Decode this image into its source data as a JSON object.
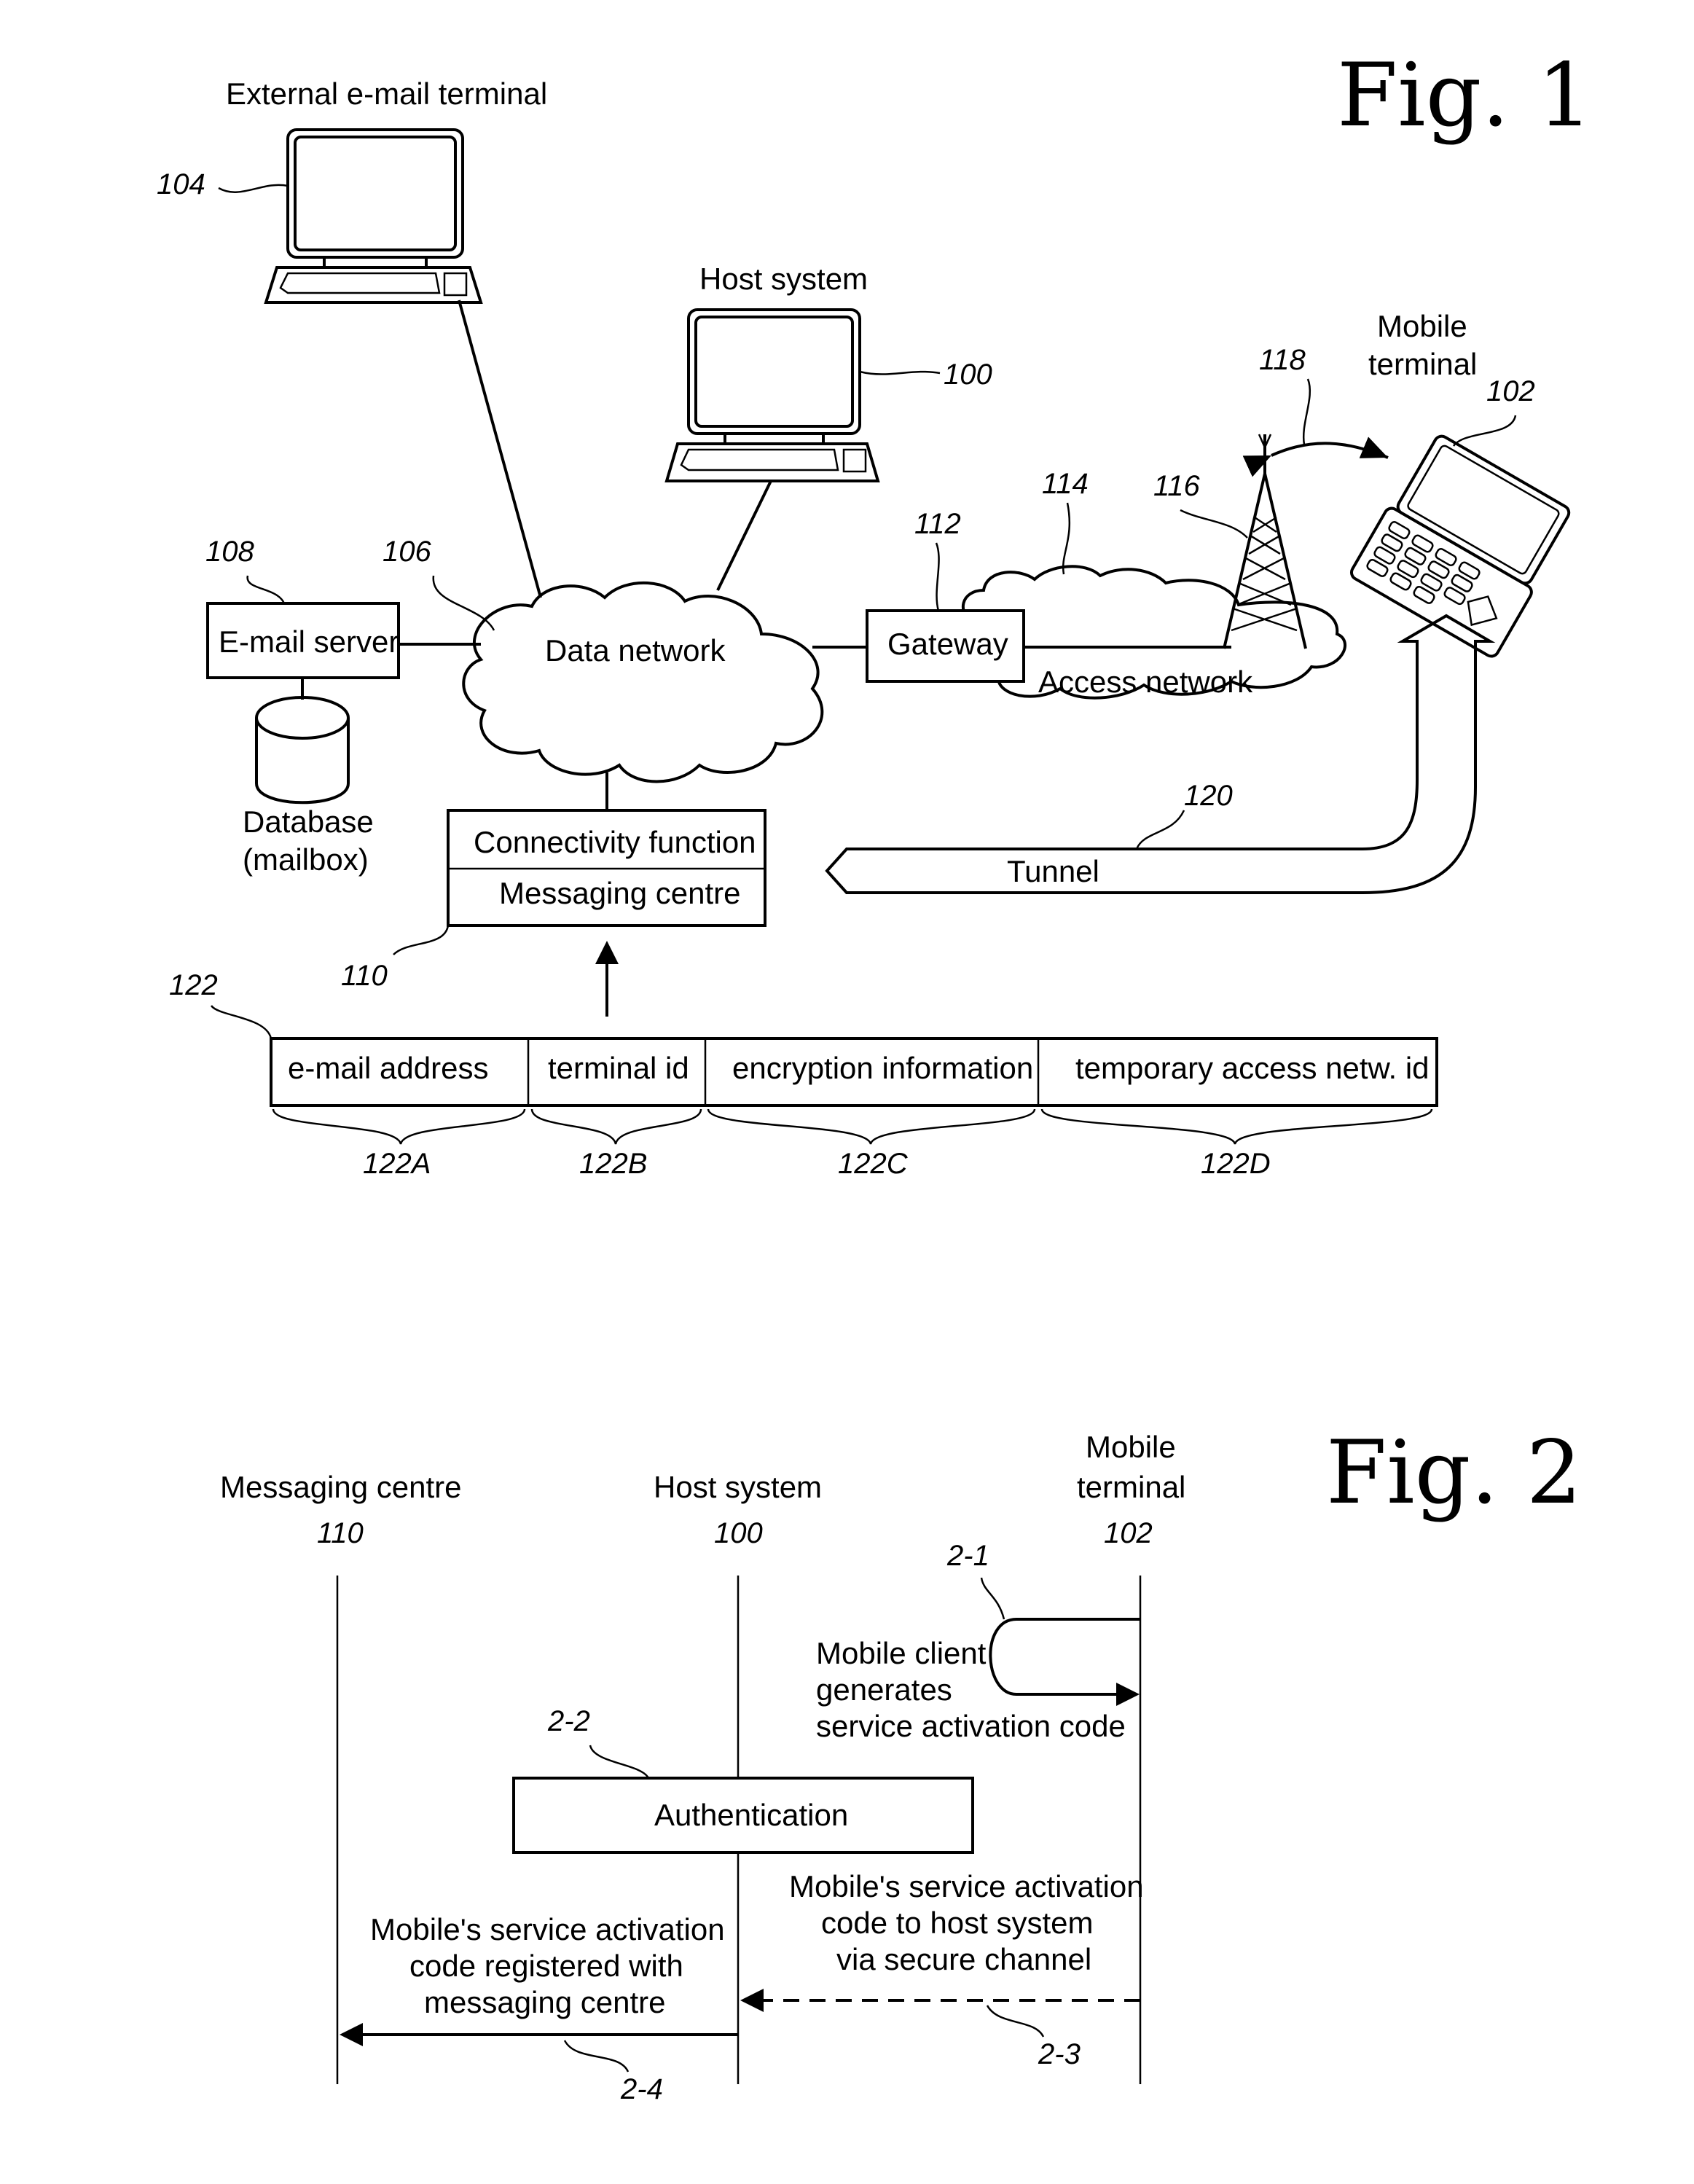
{
  "fig1": {
    "title": "Fig. 1",
    "external_terminal": {
      "label": "External e-mail terminal",
      "ref": "104"
    },
    "host_system": {
      "label": "Host system",
      "ref": "100"
    },
    "mobile_terminal": {
      "label_line1": "Mobile",
      "label_line2": "terminal",
      "ref": "102"
    },
    "radio_link_ref": "118",
    "tower_ref": "116",
    "access_network": {
      "label": "Access network",
      "ref": "114"
    },
    "gateway": {
      "label": "Gateway",
      "ref": "112"
    },
    "data_network": {
      "label": "Data network",
      "ref": "106"
    },
    "email_server": {
      "label": "E-mail server",
      "ref": "108"
    },
    "database": {
      "label_line1": "Database",
      "label_line2": "(mailbox)"
    },
    "connectivity": {
      "top": "Connectivity function",
      "bottom": "Messaging centre",
      "ref": "110"
    },
    "tunnel": {
      "label": "Tunnel",
      "ref": "120"
    },
    "message": {
      "ref": "122",
      "fields": [
        {
          "label": "e-mail address",
          "ref": "122A"
        },
        {
          "label": "terminal id",
          "ref": "122B"
        },
        {
          "label": "encryption information",
          "ref": "122C"
        },
        {
          "label": "temporary access netw. id",
          "ref": "122D"
        }
      ]
    }
  },
  "fig2": {
    "title": "Fig. 2",
    "lifelines": [
      {
        "label": "Messaging centre",
        "ref": "110"
      },
      {
        "label": "Host system",
        "ref": "100"
      },
      {
        "label_line1": "Mobile",
        "label_line2": "terminal",
        "ref": "102"
      }
    ],
    "steps": {
      "s1": {
        "ref": "2-1",
        "lines": [
          "Mobile client",
          "generates",
          "service activation code"
        ]
      },
      "s2": {
        "ref": "2-2",
        "label": "Authentication"
      },
      "s3": {
        "ref": "2-3",
        "lines": [
          "Mobile's service activation",
          "code to host system",
          "via secure channel"
        ]
      },
      "s4": {
        "ref": "2-4",
        "lines": [
          "Mobile's service activation",
          "code registered with",
          "messaging centre"
        ]
      }
    }
  }
}
